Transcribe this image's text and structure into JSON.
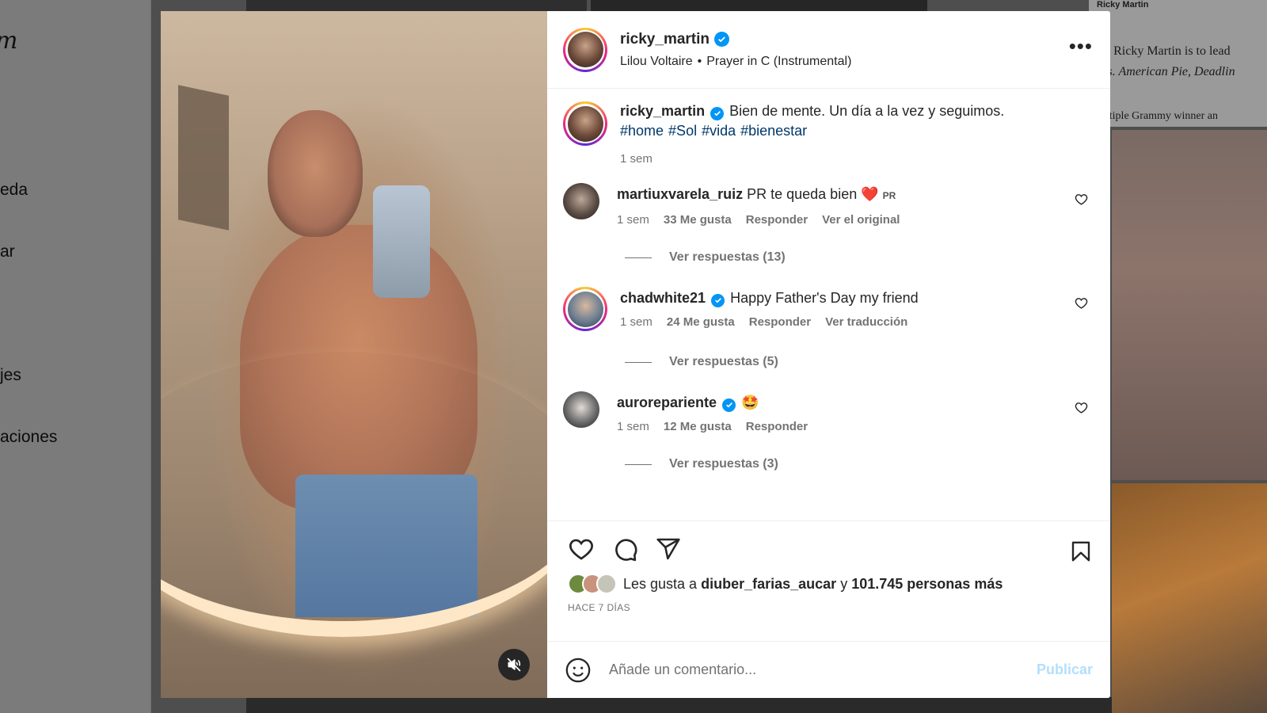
{
  "background": {
    "logo_fragment": "m",
    "nav_fragments": [
      "eda",
      "ar",
      "jes",
      "aciones"
    ],
    "article_header": "Ricky Martin",
    "article_lines": [
      "star Ricky Martin is to lead",
      "Mrs. American Pie, Deadlin",
      "multiple Grammy winner an"
    ]
  },
  "post": {
    "author": "ricky_martin",
    "audio_artist": "Lilou Voltaire",
    "audio_separator": "•",
    "audio_track": "Prayer in C (Instrumental)",
    "more_label": "•••",
    "caption": {
      "user": "ricky_martin",
      "text": "Bien de mente. Un día a la vez y seguimos.",
      "hashtags": [
        "#home",
        "#Sol",
        "#vida",
        "#bienestar"
      ],
      "time": "1 sem"
    },
    "comments": [
      {
        "user": "martiuxvarela_ruiz",
        "verified": false,
        "text": "PR te queda bien",
        "emoji": "❤️",
        "tag": "PR",
        "time": "1 sem",
        "likes": "33 Me gusta",
        "reply": "Responder",
        "extra": "Ver el original",
        "replies": "Ver respuestas (13)"
      },
      {
        "user": "chadwhite21",
        "verified": true,
        "text": "Happy Father's Day my friend",
        "time": "1 sem",
        "likes": "24 Me gusta",
        "reply": "Responder",
        "extra": "Ver traducción",
        "replies": "Ver respuestas (5)"
      },
      {
        "user": "aurorepariente",
        "verified": true,
        "emoji": "🤩",
        "time": "1 sem",
        "likes": "12 Me gusta",
        "reply": "Responder",
        "replies": "Ver respuestas (3)"
      }
    ],
    "likes": {
      "prefix": "Les gusta a",
      "user": "diuber_farias_aucar",
      "joiner": "y",
      "others": "101.745 personas más"
    },
    "date": "HACE 7 DÍAS",
    "comment_placeholder": "Añade un comentario...",
    "publish_label": "Publicar"
  },
  "colors": {
    "accent": "#0095f6",
    "hashtag": "#00376b",
    "muted": "#737373",
    "publish_disabled": "#b2dffc",
    "heart_red": "#e0245e"
  },
  "icons": [
    "verified-badge-icon",
    "more-options-icon",
    "heart-outline-icon",
    "comment-icon",
    "share-icon",
    "bookmark-icon",
    "emoji-icon",
    "mute-icon",
    "small-heart-icon"
  ]
}
